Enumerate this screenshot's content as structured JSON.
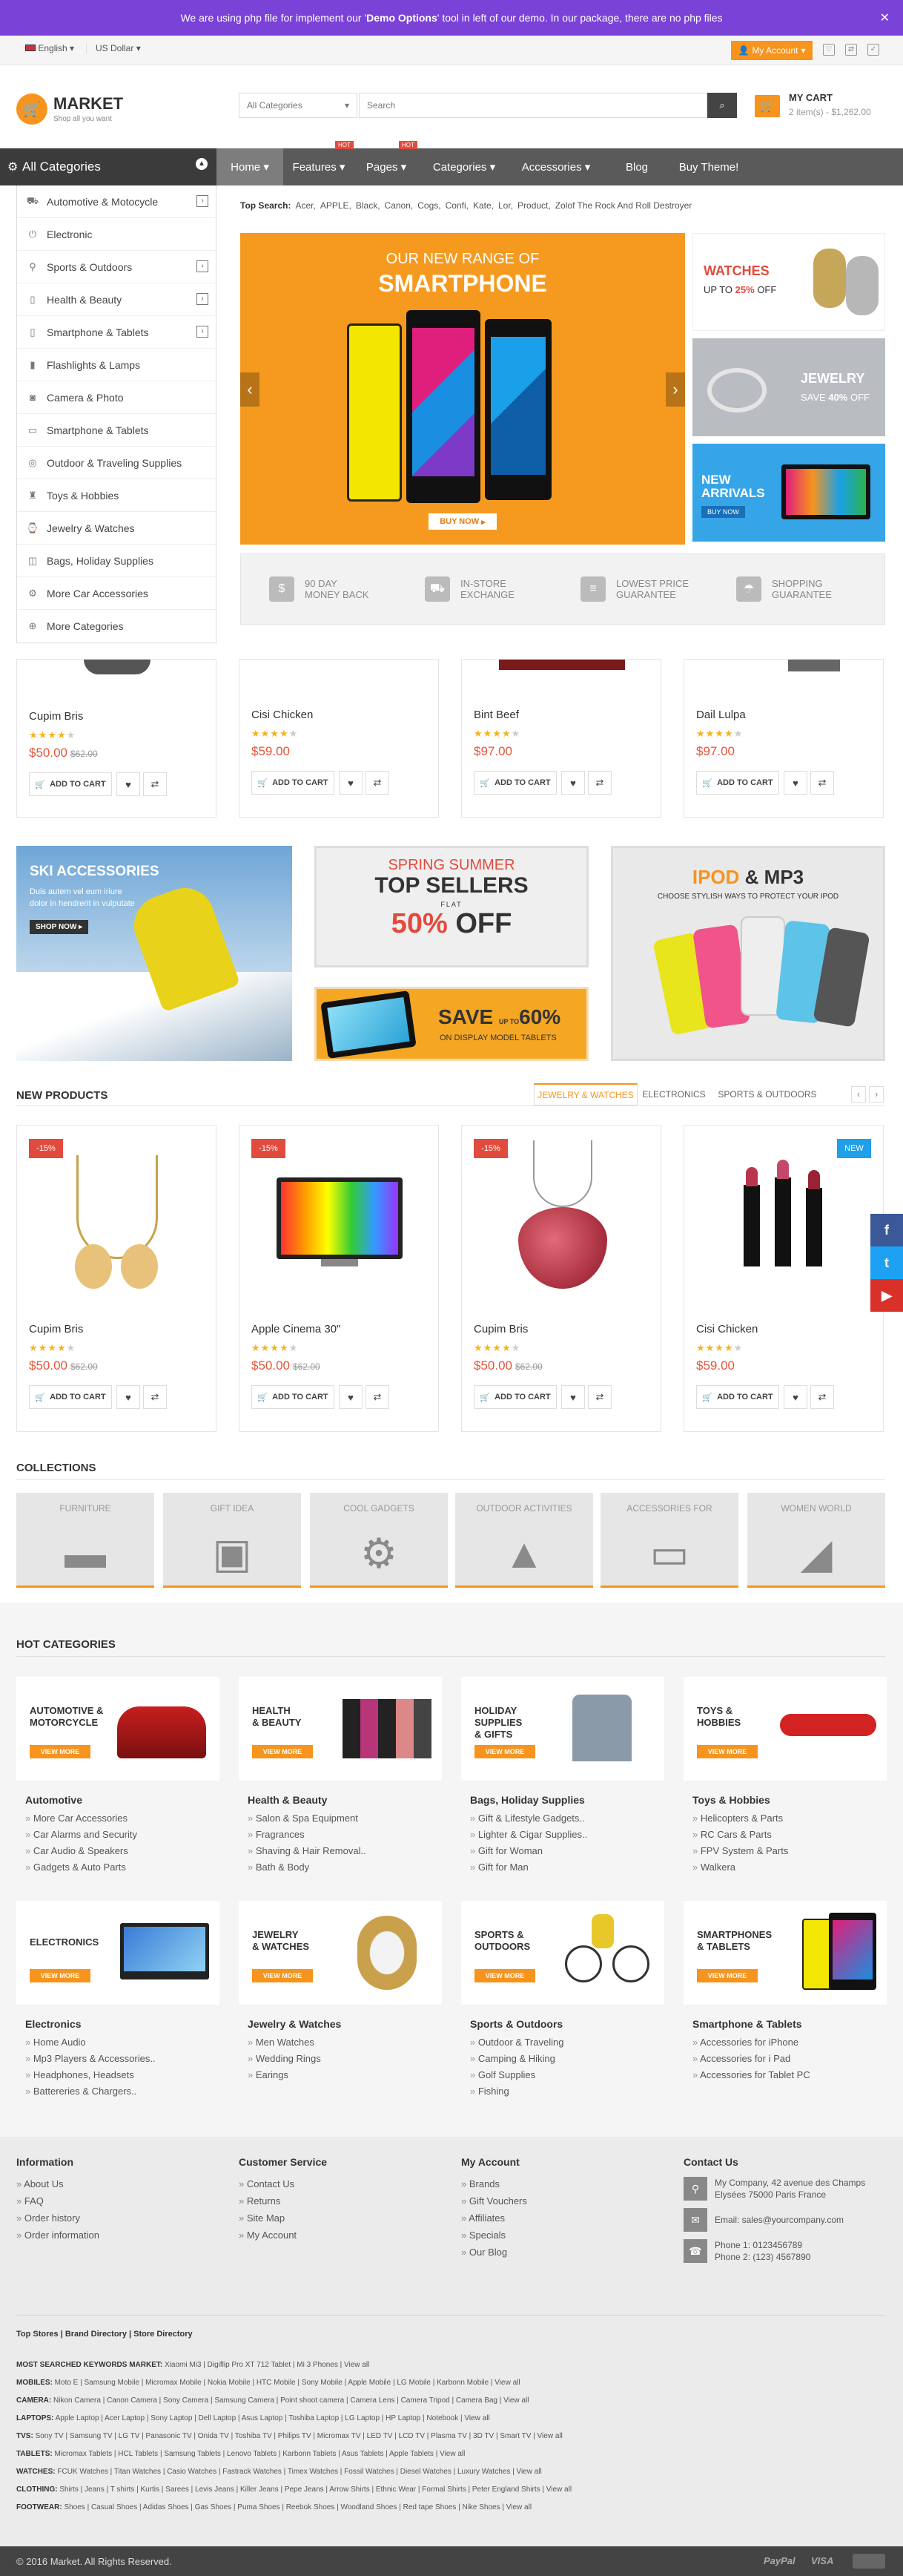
{
  "notice": {
    "prefix": "We are using php file for implement our '",
    "highlight": "Demo Options",
    "suffix": "' tool in left of our demo. In our package, there are no php files"
  },
  "topbar": {
    "language": "English",
    "currency": "US Dollar",
    "account": "My Account"
  },
  "header": {
    "logo_name": "MARKET",
    "logo_tagline": "Shop all you want",
    "search_category": "All Categories",
    "search_placeholder": "Search",
    "cart_title": "MY CART",
    "cart_summary": "2 item(s) - $1,262.00"
  },
  "nav": {
    "categories_label": "All Categories",
    "items": [
      "Home",
      "Features",
      "Pages",
      "Categories",
      "Accessories",
      "Blog",
      "Buy Theme!"
    ],
    "hot_label": "HOT"
  },
  "top_search": {
    "label": "Top Search:",
    "terms": [
      "Acer,",
      "APPLE,",
      "Black,",
      "Canon,",
      "Cogs,",
      "Confi,",
      "Kate,",
      "Lor,",
      "Product,",
      "Zolof The Rock And Roll Destroyer"
    ]
  },
  "sidebar": {
    "items": [
      {
        "label": "Automotive & Motocycle",
        "icon": "car-icon",
        "arrow": true
      },
      {
        "label": "Electronic",
        "icon": "plug-icon",
        "arrow": false
      },
      {
        "label": "Sports & Outdoors",
        "icon": "bike-icon",
        "arrow": true
      },
      {
        "label": "Health & Beauty",
        "icon": "bottle-icon",
        "arrow": true
      },
      {
        "label": "Smartphone & Tablets",
        "icon": "phone-icon",
        "arrow": true
      },
      {
        "label": "Flashlights & Lamps",
        "icon": "flashlight-icon",
        "arrow": false
      },
      {
        "label": "Camera & Photo",
        "icon": "camera-icon",
        "arrow": false
      },
      {
        "label": "Smartphone & Tablets",
        "icon": "tablet-icon",
        "arrow": false
      },
      {
        "label": "Outdoor & Traveling Supplies",
        "icon": "globe-icon",
        "arrow": false
      },
      {
        "label": "Toys & Hobbies",
        "icon": "toy-icon",
        "arrow": false
      },
      {
        "label": "Jewelry & Watches",
        "icon": "watch-icon",
        "arrow": false
      },
      {
        "label": "Bags, Holiday Supplies",
        "icon": "bag-icon",
        "arrow": false
      },
      {
        "label": "More Car Accessories",
        "icon": "car-part-icon",
        "arrow": false
      }
    ],
    "more_label": "More Categories"
  },
  "hero": {
    "subtitle": "OUR NEW RANGE OF",
    "title": "SMARTPHONE",
    "button": "BUY NOW"
  },
  "side_banners": {
    "watches": {
      "title": "WATCHES",
      "line": "UP TO",
      "pct": "25%",
      "tail": "OFF"
    },
    "jewelry": {
      "title": "JEWELRY",
      "line": "SAVE",
      "pct": "40%",
      "tail": "OFF"
    },
    "arrivals": {
      "title": "NEW",
      "title2": "ARRIVALS",
      "button": "BUY NOW"
    }
  },
  "features": [
    {
      "l1": "90 DAY",
      "l2": "MONEY BACK",
      "icon": "money-bag-icon"
    },
    {
      "l1": "IN-STORE",
      "l2": "EXCHANGE",
      "icon": "truck-icon"
    },
    {
      "l1": "LOWEST PRICE",
      "l2": "GUARANTEE",
      "icon": "price-list-icon"
    },
    {
      "l1": "SHOPPING",
      "l2": "GUARANTEE",
      "icon": "umbrella-icon"
    }
  ],
  "products_top": [
    {
      "name": "Cupim Bris",
      "rating": 4,
      "price": "$50.00",
      "old": "$62.00"
    },
    {
      "name": "Cisi Chicken",
      "rating": 4,
      "price": "$59.00",
      "old": ""
    },
    {
      "name": "Bint Beef",
      "rating": 4,
      "price": "$97.00",
      "old": ""
    },
    {
      "name": "Dail Lulpa",
      "rating": 4,
      "price": "$97.00",
      "old": ""
    }
  ],
  "add_to_cart": "ADD TO CART",
  "promo": {
    "ski": {
      "title": "SKI ACCESSORIES",
      "text1": "Duis autem vel eum iriure",
      "text2": "dolor in hendrerit in vulputate",
      "button": "SHOP NOW"
    },
    "spring": {
      "l1": "SPRING SUMMER",
      "l2": "TOP SELLERS",
      "l3": "FLAT",
      "l4": "50%",
      "l5": "OFF"
    },
    "save": {
      "big": "SAVE",
      "upto": "UP TO",
      "pct": "60%",
      "sub": "ON DISPLAY MODEL TABLETS"
    },
    "ipod": {
      "title": "IPOD",
      "amp": "& MP3",
      "sub": "CHOOSE STYLISH WAYS TO PROTECT YOUR IPOD"
    }
  },
  "new_products": {
    "title": "NEW PRODUCTS",
    "tabs": [
      "JEWELRY & WATCHES",
      "ELECTRONICS",
      "SPORTS & OUTDOORS"
    ],
    "items": [
      {
        "name": "Cupim Bris",
        "rating": 4,
        "price": "$50.00",
        "old": "$62.00",
        "badge": "-15%"
      },
      {
        "name": "Apple Cinema 30\"",
        "rating": 4,
        "price": "$50.00",
        "old": "$62.00",
        "badge": "-15%"
      },
      {
        "name": "Cupim Bris",
        "rating": 4,
        "price": "$50.00",
        "old": "$62.00",
        "badge": "-15%"
      },
      {
        "name": "Cisi Chicken",
        "rating": 4,
        "price": "$59.00",
        "old": "",
        "badge": "NEW"
      }
    ]
  },
  "collections": {
    "title": "COLLECTIONS",
    "items": [
      {
        "label": "FURNITURE",
        "icon": "sofa-icon",
        "glyph": "▬"
      },
      {
        "label": "GIFT IDEA",
        "icon": "gift-icon",
        "glyph": "▣"
      },
      {
        "label": "COOL GADGETS",
        "icon": "gear-icon",
        "glyph": "⚙"
      },
      {
        "label": "OUTDOOR ACTIVITIES",
        "icon": "tree-icon",
        "glyph": "▲"
      },
      {
        "label": "ACCESSORIES FOR",
        "icon": "devices-icon",
        "glyph": "▭"
      },
      {
        "label": "WOMEN WORLD",
        "icon": "shoe-icon",
        "glyph": "◢"
      }
    ]
  },
  "hot_categories": {
    "title": "HOT CATEGORIES",
    "view_more": "VIEW MORE",
    "items": [
      {
        "card1": "AUTOMOTIVE &",
        "card2": "MOTORCYCLE",
        "title": "Automotive",
        "links": [
          "More Car Accessories",
          "Car Alarms and Security",
          "Car Audio & Speakers",
          "Gadgets & Auto Parts"
        ]
      },
      {
        "card1": "HEALTH",
        "card2": "& BEAUTY",
        "title": "Health & Beauty",
        "links": [
          "Salon & Spa Equipment",
          "Fragrances",
          "Shaving & Hair Removal..",
          "Bath & Body"
        ]
      },
      {
        "card1": "HOLIDAY SUPPLIES",
        "card2": "& GIFTS",
        "title": "Bags, Holiday Supplies",
        "links": [
          "Gift & Lifestyle Gadgets..",
          "Lighter & Cigar Supplies..",
          "Gift for Woman",
          "Gift for Man"
        ]
      },
      {
        "card1": "TOYS &",
        "card2": "HOBBIES",
        "title": "Toys & Hobbies",
        "links": [
          "Helicopters & Parts",
          "RC Cars & Parts",
          "FPV System & Parts",
          "Walkera"
        ]
      },
      {
        "card1": "ELECTRONICS",
        "card2": "",
        "title": "Electronics",
        "links": [
          "Home Audio",
          "Mp3 Players & Accessories..",
          "Headphones, Headsets",
          "Battereries & Chargers.."
        ]
      },
      {
        "card1": "JEWELRY",
        "card2": "& WATCHES",
        "title": "Jewelry & Watches",
        "links": [
          "Men Watches",
          "Wedding Rings",
          "Earings"
        ]
      },
      {
        "card1": "SPORTS &",
        "card2": "OUTDOORS",
        "title": "Sports & Outdoors",
        "links": [
          "Outdoor & Traveling",
          "Camping & Hiking",
          "Golf Supplies",
          "Fishing"
        ]
      },
      {
        "card1": "SMARTPHONES",
        "card2": "& TABLETS",
        "title": "Smartphone & Tablets",
        "links": [
          "Accessories for iPhone",
          "Accessories for i Pad",
          "Accessories for Tablet PC"
        ]
      }
    ]
  },
  "footer": {
    "information": {
      "title": "Information",
      "links": [
        "About Us",
        "FAQ",
        "Order history",
        "Order information"
      ]
    },
    "service": {
      "title": "Customer Service",
      "links": [
        "Contact Us",
        "Returns",
        "Site Map",
        "My Account"
      ]
    },
    "account": {
      "title": "My Account",
      "links": [
        "Brands",
        "Gift Vouchers",
        "Affiliates",
        "Specials",
        "Our Blog"
      ]
    },
    "contact": {
      "title": "Contact Us",
      "address1": "My Company, 42 avenue des Champs",
      "address2": "Elysées 75000 Paris France",
      "email": "Email: sales@yourcompany.com",
      "phone1": "Phone 1: 0123456789",
      "phone2": "Phone 2: (123) 4567890"
    },
    "stores_title": "Top Stores | Brand Directory | Store Directory",
    "tag_rows": [
      {
        "k": "MOST SEARCHED KEYWORDS MARKET:",
        "v": "Xiaomi Mi3 | Digiflip Pro XT 712 Tablet | Mi 3 Phones | View all"
      },
      {
        "k": "MOBILES:",
        "v": "Moto E | Samsung Mobile | Micromax Mobile | Nokia Mobile | HTC Mobile | Sony Mobile | Apple Mobile | LG Mobile | Karbonn Mobile | View all"
      },
      {
        "k": "CAMERA:",
        "v": "Nikon Camera | Canon Camera | Sony Camera | Samsung Camera | Point shoot camera | Camera Lens | Camera Tripod | Camera Bag | View all"
      },
      {
        "k": "LAPTOPS:",
        "v": "Apple Laptop | Acer Laptop | Sony Laptop | Dell Laptop | Asus Laptop | Toshiba Laptop | LG Laptop | HP Laptop | Notebook | View all"
      },
      {
        "k": "TVS:",
        "v": "Sony TV | Samsung TV | LG TV | Panasonic TV | Onida TV | Toshiba TV | Philips TV | Micromax TV | LED TV | LCD TV | Plasma TV | 3D TV | Smart TV | View all"
      },
      {
        "k": "TABLETS:",
        "v": "Micromax Tablets | HCL Tablets | Samsung Tablets | Lenovo Tablets | Karbonn Tablets | Asus Tablets | Apple Tablets | View all"
      },
      {
        "k": "WATCHES:",
        "v": "FCUK Watches | Titan Watches | Casio Watches | Fastrack Watches | Timex Watches | Fossil Watches | Diesel Watches | Luxury Watches | View all"
      },
      {
        "k": "CLOTHING:",
        "v": "Shirts | Jeans | T shirts | Kurtis | Sarees | Levis Jeans | Killer Jeans | Pepe Jeans | Arrow Shirts | Ethnic Wear | Formal Shirts | Peter England Shirts | View all"
      },
      {
        "k": "FOOTWEAR:",
        "v": "Shoes | Casual Shoes | Adidas Shoes | Gas Shoes | Puma Shoes | Reebok Shoes | Woodland Shoes | Red tape Shoes | Nike Shoes | View all"
      }
    ],
    "copyright": "© 2016 Market. All Rights Reserved.",
    "payments": [
      "PayPal",
      "VISA"
    ]
  },
  "colors": {
    "accent": "#f7941d",
    "notice": "#7b42d8",
    "nav": "#5a5a5a",
    "sale": "#e14b3d"
  }
}
